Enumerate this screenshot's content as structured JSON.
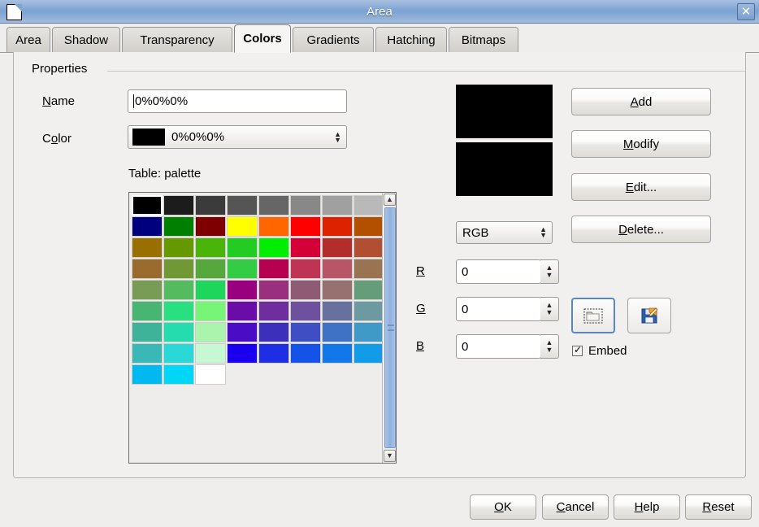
{
  "window": {
    "title": "Area",
    "icon": "document-icon",
    "close_label": "✕"
  },
  "tabs": [
    {
      "label": "Area",
      "active": false
    },
    {
      "label": "Shadow",
      "active": false
    },
    {
      "label": "Transparency",
      "active": false
    },
    {
      "label": "Colors",
      "active": true
    },
    {
      "label": "Gradients",
      "active": false
    },
    {
      "label": "Hatching",
      "active": false
    },
    {
      "label": "Bitmaps",
      "active": false
    }
  ],
  "properties": {
    "group_label": "Properties",
    "name_label_pre": "N",
    "name_label_post": "ame",
    "name_value": "0%0%0%",
    "color_label_pre": "C",
    "color_label_mid": "o",
    "color_label_post": "lor",
    "color_value": "0%0%0%",
    "color_swatch": "#000000",
    "table_label": "Table: palette"
  },
  "palette": {
    "selected_index": 0,
    "columns": 8,
    "colors": [
      "#000000",
      "#1c1c1c",
      "#3b3b3b",
      "#555555",
      "#666666",
      "#888888",
      "#a0a0a0",
      "#b9b9b9",
      "#00007f",
      "#007f00",
      "#7f0000",
      "#ffff00",
      "#ff6600",
      "#ff0000",
      "#dd2200",
      "#b35000",
      "#997000",
      "#669900",
      "#4bb409",
      "#22cc22",
      "#00ee00",
      "#d40038",
      "#b42d2d",
      "#b14f33",
      "#9a6b2e",
      "#709936",
      "#56a73c",
      "#33cc44",
      "#b80050",
      "#bf3355",
      "#b85566",
      "#9a7352",
      "#789b55",
      "#55bb5f",
      "#1fd65c",
      "#990080",
      "#9b2f7f",
      "#8e5a74",
      "#97716f",
      "#659d7b",
      "#49b573",
      "#28e07f",
      "#77f577",
      "#6a0da8",
      "#6f2e9e",
      "#6d519f",
      "#68709d",
      "#6c9aa0",
      "#3fb39a",
      "#25dcae",
      "#aaf4ad",
      "#4b0cc6",
      "#3b2fbc",
      "#3f4fc3",
      "#3f72c4",
      "#3f9ac8",
      "#3ab8b8",
      "#2ad8d8",
      "#c8f7d4",
      "#1a00ee",
      "#1d2ee4",
      "#1553e8",
      "#1277e8",
      "#129ce8",
      "#00b9f0",
      "#00d7f7",
      "#ffffff"
    ]
  },
  "preview": {
    "old_color": "#000000",
    "new_color": "#000000"
  },
  "model": {
    "selected": "RGB"
  },
  "channels": [
    {
      "label": "R",
      "value": "0"
    },
    {
      "label": "G",
      "value": "0"
    },
    {
      "label": "B",
      "value": "0"
    }
  ],
  "side_buttons": [
    {
      "key": "add",
      "pre": "A",
      "post": "dd"
    },
    {
      "key": "modify",
      "pre": "M",
      "post": "odify"
    },
    {
      "key": "edit",
      "pre": "E",
      "post": "dit..."
    },
    {
      "key": "delete",
      "pre": "D",
      "post": "elete..."
    }
  ],
  "icon_buttons": {
    "load_name": "load-palette-icon",
    "save_name": "save-palette-icon"
  },
  "embed": {
    "label": "Embed",
    "checked": true
  },
  "bottom_buttons": [
    {
      "key": "ok",
      "pre": "O",
      "post": "K"
    },
    {
      "key": "cancel",
      "pre": "C",
      "post": "ancel"
    },
    {
      "key": "help",
      "pre": "H",
      "post": "elp"
    },
    {
      "key": "reset",
      "pre": "R",
      "post": "eset"
    }
  ]
}
